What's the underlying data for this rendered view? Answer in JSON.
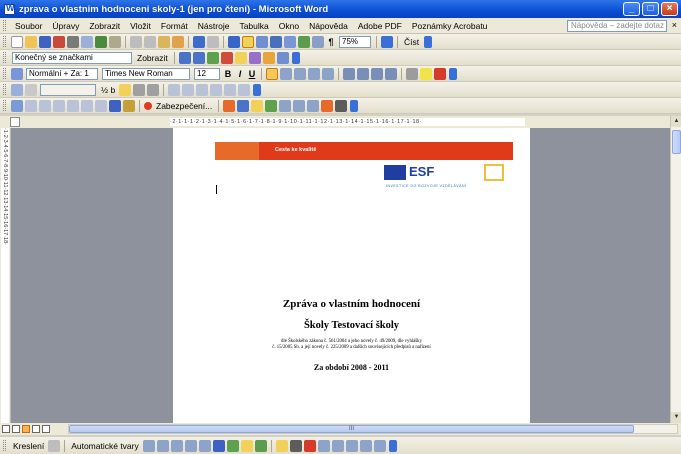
{
  "window": {
    "title": "zprava o vlastnim hodnoceni skoly-1 (jen pro čtení) - Microsoft Word",
    "controls": [
      "_",
      "□",
      "×"
    ]
  },
  "menubar": {
    "items": [
      "Soubor",
      "Úpravy",
      "Zobrazit",
      "Vložit",
      "Formát",
      "Nástroje",
      "Tabulka",
      "Okno",
      "Nápověda",
      "Adobe PDF",
      "Poznámky Acrobatu"
    ],
    "help_placeholder": "Nápověda – zadejte dotaz",
    "close_symbol": "×"
  },
  "toolbar_standard": {
    "zoom": "75%",
    "read_label": "Číst"
  },
  "toolbar_tracking": {
    "display_mode": "Konečný se značkami",
    "show_label": "Zobrazit"
  },
  "toolbar_formatting": {
    "style": "Normální + Za: 1",
    "font": "Times New Roman",
    "size": "12",
    "bold": "B",
    "italic": "I",
    "underline": "U"
  },
  "toolbar_acrobat": {
    "line_weight": "½ b",
    "review_label": "Zabezpečení..."
  },
  "ruler": {
    "horizontal_marks": "·2·1·1·1·2·1·3·1·4·1·5·1·6·1·7·1·8·1·9·1·10·1·11·1·12·1·13·1·14·1·15·1·16·1·17·1·18·",
    "vertical_marks": "·1·2·3·4·5·6·7·8·9·10·11·12·13·14·15·16·17·18·"
  },
  "document": {
    "banner_text": "Cesta ke kvalitě",
    "logo_esf": "ESF",
    "logo_msmt": "MŠMT",
    "investment_slogan": "INVESTICE DO ROZVOJE VZDĚLÁVÁNÍ",
    "heading1": "Zpráva o vlastním hodnocení",
    "heading2": "Školy Testovací školy",
    "legal_note_1": "dle Školského zákona č. 561/2004 a jeho novely č. 49/2009, dle vyhlášky",
    "legal_note_2": "č. 15/2005 Sb. a její novely č. 225/2009 a dalších souvisejících předpisů a nařízení",
    "period": "Za období 2008 - 2011"
  },
  "drawing_toolbar": {
    "draw_label": "Kreslení",
    "autoshapes_label": "Automatické tvary"
  },
  "colors": {
    "title_bar": "#0a4fd4",
    "banner": "#e03a1b",
    "workspace": "#8d929d"
  }
}
